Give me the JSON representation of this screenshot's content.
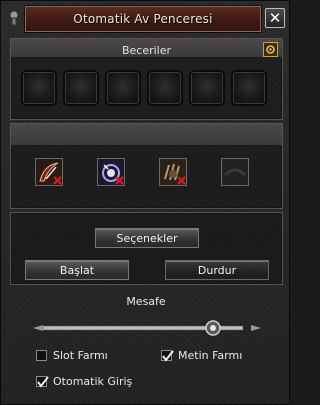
{
  "window": {
    "title": "Otomatik Av Penceresi",
    "close_label": "✕"
  },
  "skills_section": {
    "header": "Beceriler",
    "empty_slots": 6,
    "skills": [
      {
        "icon": "skill-blade-icon",
        "disabled": true
      },
      {
        "icon": "skill-orb-icon",
        "disabled": true
      },
      {
        "icon": "skill-claw-icon",
        "disabled": true
      },
      {
        "icon": "skill-empty-icon",
        "disabled": false
      }
    ]
  },
  "options": {
    "options_button": "Seçenekler",
    "start_button": "Başlat",
    "stop_button": "Durdur"
  },
  "distance": {
    "label": "Mesafe",
    "slider_value": 0.85
  },
  "checkboxes": [
    {
      "label": "Slot Farmı",
      "checked": false
    },
    {
      "label": "Metin Farmı",
      "checked": true
    },
    {
      "label": "Otomatik Giriş",
      "checked": true
    }
  ],
  "colors": {
    "title_plate": "#4a2018",
    "accent_gold": "#c9a23a",
    "disabled_red": "#e01b1b"
  }
}
